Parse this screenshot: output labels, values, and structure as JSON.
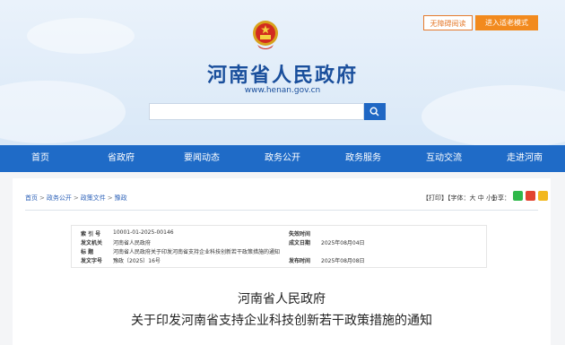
{
  "accessibility": {
    "a11y_label": "无障碍阅读",
    "elder_label": "进入适老模式"
  },
  "site": {
    "title": "河南省人民政府",
    "url": "www.henan.gov.cn"
  },
  "search": {
    "value": ""
  },
  "nav": [
    "首页",
    "省政府",
    "要闻动态",
    "政务公开",
    "政务服务",
    "互动交流",
    "走进河南"
  ],
  "breadcrumb": {
    "home": "首页",
    "public": "政务公开",
    "files": "政策文件",
    "section": "豫政"
  },
  "tools": {
    "print": "【打印】",
    "font": "【字体：",
    "big": "大",
    "mid": "中",
    "small": "小",
    "close": "】",
    "share": "分享："
  },
  "meta": {
    "index_label": "索 引 号",
    "index_value": "10001-01-2025-00146",
    "validity_label": "失效时间",
    "validity_value": "",
    "issuer_label": "发文机关",
    "issuer_value": "河南省人民政府",
    "date_label": "成文日期",
    "date_value": "2025年08月04日",
    "title_label": "标 题",
    "title_value": "河南省人民政府关于印发河南省支持企业科技创新若干政策措施的通知",
    "docno_label": "发文字号",
    "docno_value": "豫政〔2025〕16号",
    "pub_label": "发布时间",
    "pub_value": "2025年08月08日"
  },
  "document": {
    "org": "河南省人民政府",
    "title": "关于印发河南省支持企业科技创新若干政策措施的通知"
  },
  "colors": {
    "brand_blue": "#1f6bc7",
    "title_blue": "#1a4f9c",
    "orange": "#f28a1e"
  }
}
